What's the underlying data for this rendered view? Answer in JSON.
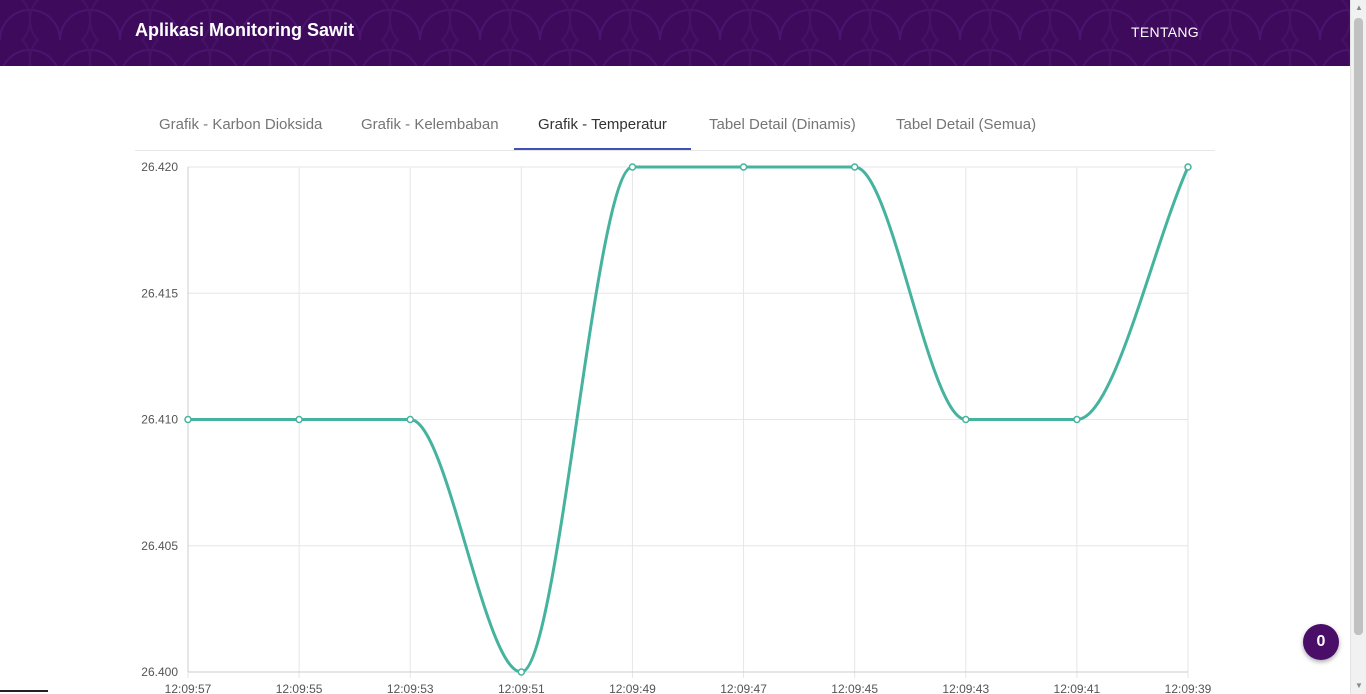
{
  "app": {
    "title": "Aplikasi Monitoring Sawit"
  },
  "nav": {
    "about_label": "TENTANG"
  },
  "tabs": [
    {
      "label": "Grafik - Karbon Dioksida",
      "active": false
    },
    {
      "label": "Grafik - Kelembaban",
      "active": false
    },
    {
      "label": "Grafik - Temperatur",
      "active": true
    },
    {
      "label": "Tabel Detail (Dinamis)",
      "active": false
    },
    {
      "label": "Tabel Detail (Semua)",
      "active": false
    }
  ],
  "colors": {
    "navbar": "#3e0a5c",
    "accent": "#3f51b5",
    "line": "#45b39d",
    "fab": "#4a0d68"
  },
  "fab": {
    "count": "0"
  },
  "chart_data": {
    "type": "line",
    "title": "",
    "xlabel": "",
    "ylabel": "",
    "x": [
      "12:09:57",
      "12:09:55",
      "12:09:53",
      "12:09:51",
      "12:09:49",
      "12:09:47",
      "12:09:45",
      "12:09:43",
      "12:09:41",
      "12:09:39"
    ],
    "series": [
      {
        "values": [
          26.41,
          26.41,
          26.41,
          26.4,
          26.42,
          26.42,
          26.42,
          26.41,
          26.41,
          26.42
        ],
        "color": "#45b39d"
      }
    ],
    "ylim": [
      26.4,
      26.42
    ],
    "yticks": [
      "26.420",
      "26.415",
      "26.410",
      "26.405",
      "26.400"
    ],
    "grid": true,
    "smooth": true,
    "legend": "none"
  }
}
